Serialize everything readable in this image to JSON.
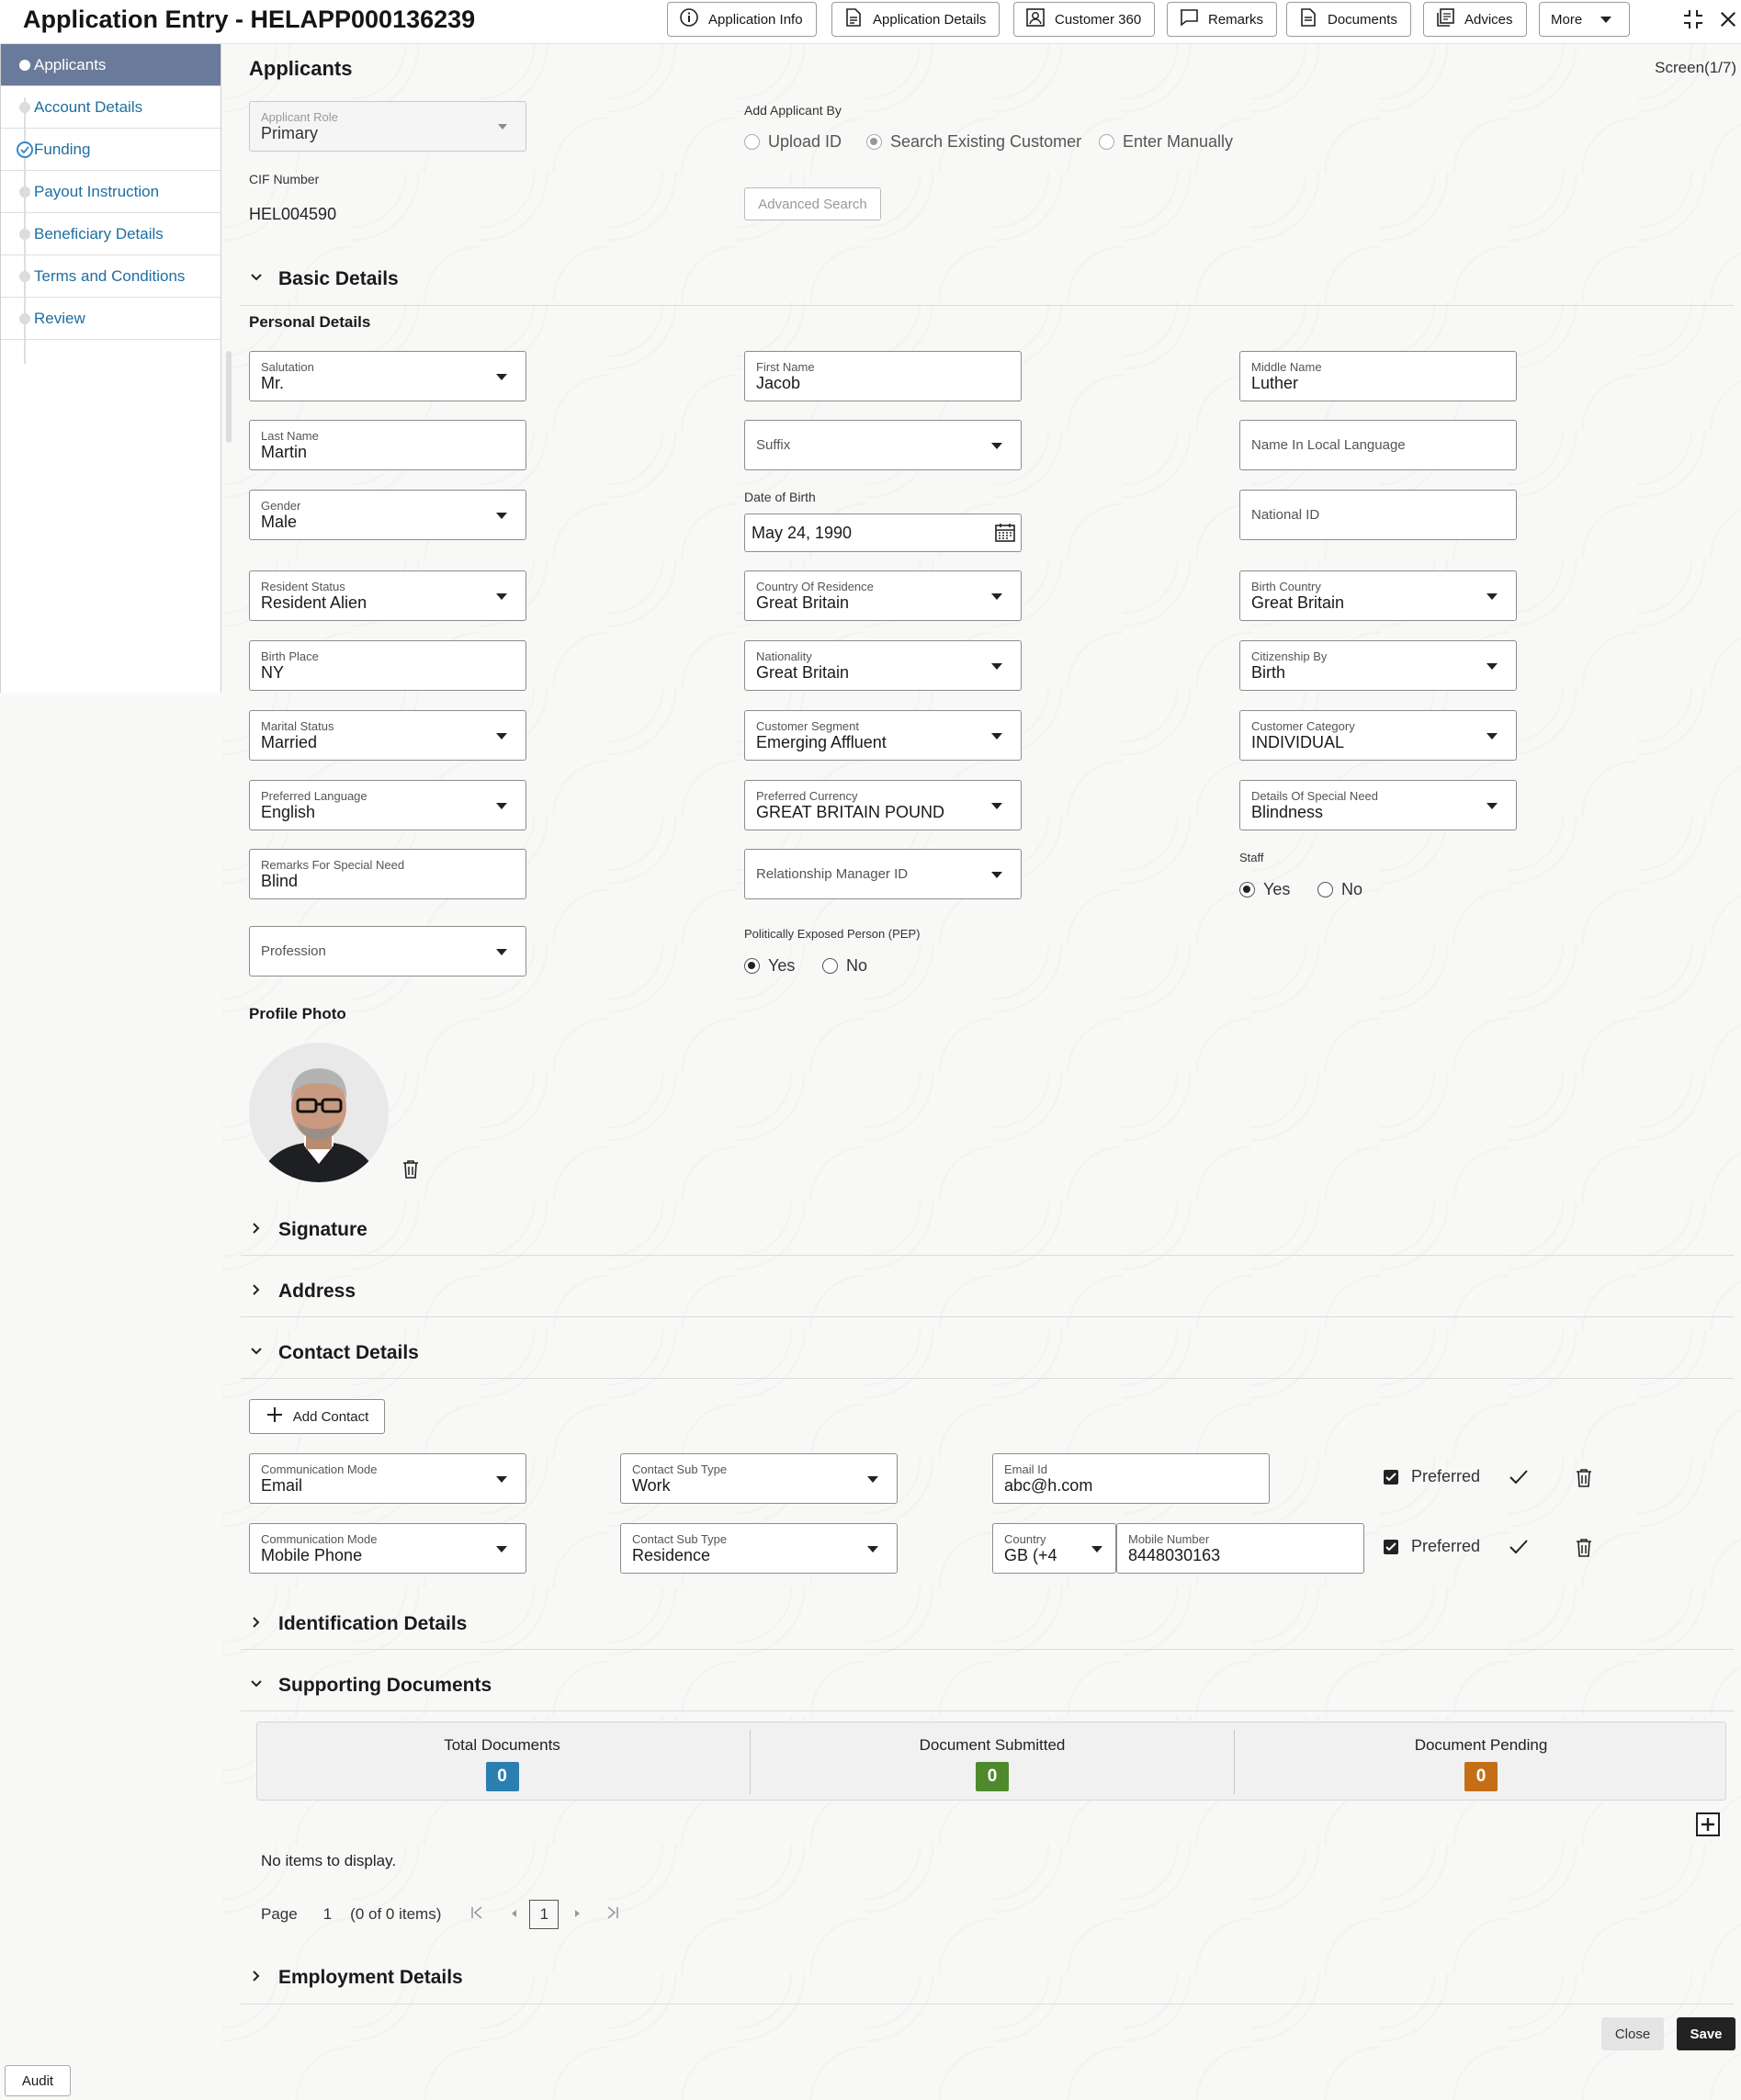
{
  "header": {
    "title": "Application Entry - HELAPP000136239",
    "buttons": [
      {
        "label": "Application Info",
        "icon": "info-icon"
      },
      {
        "label": "Application Details",
        "icon": "document-icon"
      },
      {
        "label": "Customer 360",
        "icon": "customer-icon"
      },
      {
        "label": "Remarks",
        "icon": "comment-icon"
      },
      {
        "label": "Documents",
        "icon": "documents-icon"
      },
      {
        "label": "Advices",
        "icon": "advices-icon"
      },
      {
        "label": "More",
        "icon": "caret-down-icon"
      }
    ]
  },
  "sidebar": {
    "items": [
      {
        "label": "Applicants",
        "state": "active"
      },
      {
        "label": "Account Details",
        "state": "pending"
      },
      {
        "label": "Funding",
        "state": "completed"
      },
      {
        "label": "Payout Instruction",
        "state": "pending"
      },
      {
        "label": "Beneficiary Details",
        "state": "pending"
      },
      {
        "label": "Terms and Conditions",
        "state": "pending"
      },
      {
        "label": "Review",
        "state": "pending"
      }
    ]
  },
  "main": {
    "title": "Applicants",
    "screen": "Screen(1/7)",
    "applicant_role": {
      "label": "Applicant Role",
      "value": "Primary"
    },
    "add_applicant_by": {
      "label": "Add Applicant By",
      "options": [
        "Upload ID",
        "Search Existing Customer",
        "Enter Manually"
      ],
      "selected": "Search Existing Customer"
    },
    "cif": {
      "label": "CIF Number",
      "value": "HEL004590"
    },
    "advanced_search": "Advanced Search"
  },
  "basic_details": {
    "section_title": "Basic Details",
    "personal_title": "Personal Details",
    "salutation": {
      "label": "Salutation",
      "value": "Mr."
    },
    "first_name": {
      "label": "First Name",
      "value": "Jacob"
    },
    "middle_name": {
      "label": "Middle Name",
      "value": "Luther"
    },
    "last_name": {
      "label": "Last Name",
      "value": "Martin"
    },
    "suffix": {
      "placeholder": "Suffix"
    },
    "name_local": {
      "placeholder": "Name In Local Language"
    },
    "gender": {
      "label": "Gender",
      "value": "Male"
    },
    "dob": {
      "label": "Date of Birth",
      "value": "May 24, 1990"
    },
    "national_id": {
      "placeholder": "National ID"
    },
    "resident_status": {
      "label": "Resident Status",
      "value": "Resident Alien"
    },
    "country_residence": {
      "label": "Country Of Residence",
      "value": "Great Britain"
    },
    "birth_country": {
      "label": "Birth Country",
      "value": "Great Britain"
    },
    "birth_place": {
      "label": "Birth Place",
      "value": "NY"
    },
    "nationality": {
      "label": "Nationality",
      "value": "Great Britain"
    },
    "citizenship_by": {
      "label": "Citizenship By",
      "value": "Birth"
    },
    "marital_status": {
      "label": "Marital Status",
      "value": "Married"
    },
    "customer_segment": {
      "label": "Customer Segment",
      "value": "Emerging Affluent"
    },
    "customer_category": {
      "label": "Customer Category",
      "value": "INDIVIDUAL"
    },
    "preferred_language": {
      "label": "Preferred Language",
      "value": "English"
    },
    "preferred_currency": {
      "label": "Preferred Currency",
      "value": "GREAT BRITAIN POUND"
    },
    "special_need": {
      "label": "Details Of Special Need",
      "value": "Blindness"
    },
    "remarks_special_need": {
      "label": "Remarks For Special Need",
      "value": "Blind"
    },
    "relationship_manager": {
      "placeholder": "Relationship Manager ID"
    },
    "staff": {
      "label": "Staff",
      "yes": "Yes",
      "no": "No",
      "selected": "Yes"
    },
    "profession": {
      "placeholder": "Profession"
    },
    "pep": {
      "label": "Politically Exposed Person (PEP)",
      "yes": "Yes",
      "no": "No",
      "selected": "Yes"
    },
    "profile_photo_title": "Profile Photo"
  },
  "sections": {
    "signature": "Signature",
    "address": "Address",
    "contact_details": "Contact Details",
    "identification_details": "Identification Details",
    "supporting_documents": "Supporting Documents",
    "employment_details": "Employment Details"
  },
  "contact": {
    "add_contact": "Add Contact",
    "rows": [
      {
        "mode_label": "Communication Mode",
        "mode": "Email",
        "subtype_label": "Contact Sub Type",
        "subtype": "Work",
        "value_label": "Email Id",
        "value": "abc@h.com",
        "preferred": "Preferred"
      },
      {
        "mode_label": "Communication Mode",
        "mode": "Mobile Phone",
        "subtype_label": "Contact Sub Type",
        "subtype": "Residence",
        "country_label": "Country",
        "country": "GB (+4",
        "value_label": "Mobile Number",
        "value": "8448030163",
        "preferred": "Preferred"
      }
    ]
  },
  "documents": {
    "total_label": "Total Documents",
    "total": "0",
    "submitted_label": "Document Submitted",
    "submitted": "0",
    "pending_label": "Document Pending",
    "pending": "0",
    "colors": {
      "total": "#2b7fb0",
      "submitted": "#4e8a2c",
      "pending": "#c46f18"
    },
    "empty": "No items to display.",
    "pager": {
      "page_label": "Page",
      "page": "1",
      "items": "(0 of 0 items)",
      "current": "1"
    }
  },
  "footer": {
    "close": "Close",
    "save": "Save",
    "audit": "Audit"
  }
}
